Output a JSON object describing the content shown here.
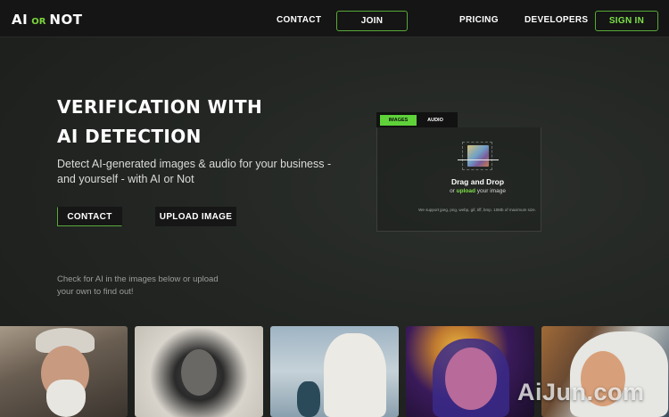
{
  "nav": {
    "logo_left": "AI",
    "logo_or": "OR",
    "logo_right": "NOT",
    "contact": "CONTACT",
    "join": "JOIN",
    "pricing": "PRICING",
    "developers": "DEVELOPERS",
    "signin": "SIGN IN"
  },
  "hero": {
    "title_line1": "VERIFICATION WITH",
    "title_line2": "AI DETECTION",
    "subtitle": "Detect AI-generated images & audio for your business - and yourself - with AI or Not",
    "contact_button": "CONTACT",
    "upload_button": "UPLOAD IMAGE",
    "hint": "Check for AI in the images below or upload your own to find out!"
  },
  "uploader": {
    "tabs": [
      "IMAGES",
      "AUDIO"
    ],
    "active_tab": "IMAGES",
    "title": "Drag and Drop",
    "or_text": "or",
    "upload_link": "upload",
    "image_text": "your image",
    "note": "We support jpeg, png, webp, gif, tiff, bmp. 10Mb of maximum size."
  },
  "colors": {
    "accent": "#7ee04a",
    "nav_bg": "#141514",
    "page_bg": "#232623"
  },
  "watermark": "AiJun.com"
}
